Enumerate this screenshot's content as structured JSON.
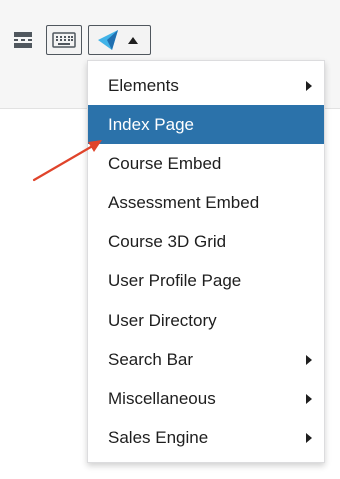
{
  "toolbar": {
    "buttons": [
      {
        "icon": "read-more-icon"
      },
      {
        "icon": "keyboard-icon"
      },
      {
        "icon": "plugin-logo-icon",
        "caret": "caret-down-icon"
      }
    ]
  },
  "menu": {
    "items": [
      {
        "label": "Elements",
        "submenu": true
      },
      {
        "label": "Index Page",
        "submenu": false,
        "active": true
      },
      {
        "label": "Course Embed",
        "submenu": false
      },
      {
        "label": "Assessment Embed",
        "submenu": false
      },
      {
        "label": "Course 3D Grid",
        "submenu": false
      },
      {
        "label": "User Profile Page",
        "submenu": false
      },
      {
        "label": "User Directory",
        "submenu": false
      },
      {
        "label": "Search Bar",
        "submenu": true
      },
      {
        "label": "Miscellaneous",
        "submenu": true
      },
      {
        "label": "Sales Engine",
        "submenu": true
      }
    ]
  },
  "colors": {
    "active_background": "#2b72aa",
    "annotation_arrow": "#e0442b",
    "logo_light": "#41b3e8",
    "logo_dark": "#1f6fb0"
  }
}
